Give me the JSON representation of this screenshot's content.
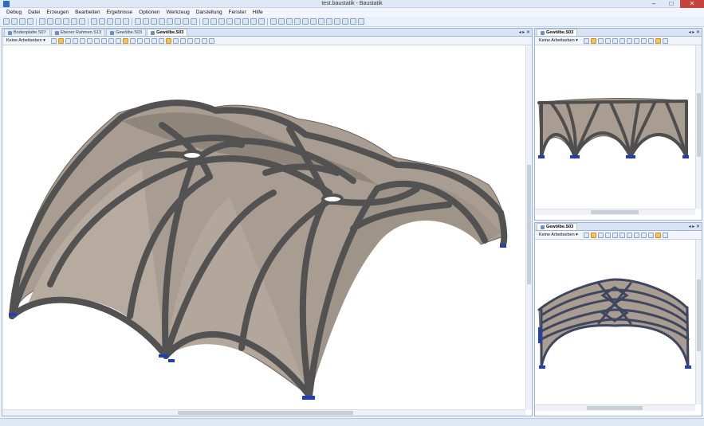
{
  "window": {
    "title": "test.baustatik - Baustatik",
    "minimize_glyph": "–",
    "maximize_glyph": "□",
    "close_glyph": "✕"
  },
  "menu": [
    "Debug",
    "Datei",
    "Erzeugen",
    "Bearbeiten",
    "Ergebnisse",
    "Optionen",
    "Werkzeug",
    "Darstellung",
    "Fenster",
    "Hilfe"
  ],
  "main_pane": {
    "tabs": [
      {
        "label": "Bodenplatte.S07",
        "active": false
      },
      {
        "label": "Ebener Rahmen.S13",
        "active": false
      },
      {
        "label": "Gewölbe.S03",
        "active": false
      },
      {
        "label": "Gewölbe.S03",
        "active": true
      }
    ],
    "layer_selector": "Keine Arbeitseben ▾",
    "tab_controls": "◂ ▸ ✕"
  },
  "top_right_pane": {
    "tab": {
      "label": "Gewölbe.S03"
    },
    "layer_selector": "Keine Arbeitseben ▾",
    "tab_controls": "◂ ▸ ✕"
  },
  "bottom_right_pane": {
    "tab": {
      "label": "Gewölbe.S03"
    },
    "layer_selector": "Keine Arbeitseben ▾",
    "tab_controls": "◂ ▸ ✕"
  },
  "colors": {
    "vault_surface": "#a99d91",
    "rib": "#525252",
    "rib_edge": "#3a3a3a",
    "support": "#1f3fb8",
    "highlight_tool": "#f3c25b"
  },
  "icons": {
    "toolbar": [
      "new-file-icon",
      "open-icon",
      "save-icon",
      "print-icon",
      "undo-icon",
      "redo-icon",
      "zoom-icon",
      "select-icon",
      "node-icon",
      "beam-icon",
      "load-icon",
      "calc-icon"
    ],
    "view_toolbar": [
      "pointer-icon",
      "pan-icon",
      "zoom-in-icon",
      "zoom-out-icon",
      "move-icon",
      "zoom-window-icon",
      "zoom-all-icon",
      "rotate-icon",
      "view-icon",
      "lock-icon"
    ]
  }
}
